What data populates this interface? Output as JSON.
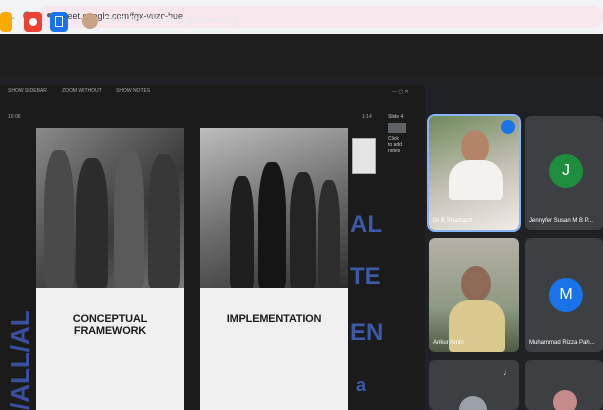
{
  "browser": {
    "back_glyph": "←",
    "reload_glyph": "C",
    "url": "meet.google.com/fgx-vuzc-hue",
    "lock_icon": "lock-icon"
  },
  "meet_top": {
    "presenting_text": "Dr B Shadrach is presenting",
    "button_colors": [
      "#f9ab00",
      "#ea4335",
      "#1a73e8"
    ]
  },
  "share_toolbar": {
    "items": [
      "SHOW SIDEBAR",
      "ZOOM WITHOUT",
      "SHOW NOTES"
    ],
    "page_left": "10  06",
    "zoom_right": "1:14"
  },
  "slides": [
    {
      "label": "CONCEPTUAL FRAMEWORK"
    },
    {
      "label": "IMPLEMENTATION"
    }
  ],
  "slide_side_text": [
    "AL",
    "TE",
    "EN",
    "a"
  ],
  "slide_left_text": "/ALL/AL",
  "side_notes": {
    "title": "Slide 4",
    "line1": "Click",
    "line2": "to add",
    "line3": "notes"
  },
  "tiles": [
    {
      "name": "Dr B Shadrach",
      "active": true,
      "kind": "video"
    },
    {
      "name": "Jennyfer Susan M B P...",
      "initial": "J",
      "color": "#1e8e3e",
      "kind": "avatar"
    },
    {
      "name": "Ankur Amin",
      "kind": "video"
    },
    {
      "name": "Muhammad Rizza Pah...",
      "initial": "M",
      "color": "#1a73e8",
      "kind": "avatar"
    },
    {
      "name": "",
      "kind": "video"
    },
    {
      "name": "",
      "kind": "video"
    }
  ]
}
